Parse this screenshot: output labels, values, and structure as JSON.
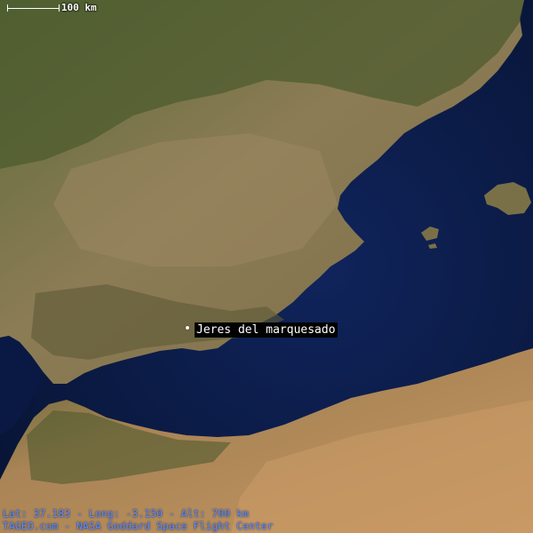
{
  "map": {
    "scale_label": "100 km",
    "place_name": "Jeres del marquesado",
    "coordinates_text": "Lat: 37.183 - Long: -3.150 - Alt: 700 km",
    "credit_text": "TAGEO.com - NASA Goddard Space Flight Center",
    "colors": {
      "sea": "#0b1a4a",
      "land": "#8a7a52",
      "vegetation": "#4f5e2e",
      "desert": "#b88d5e",
      "label_bg": "#000000",
      "info_text": "#5b8cff"
    }
  }
}
